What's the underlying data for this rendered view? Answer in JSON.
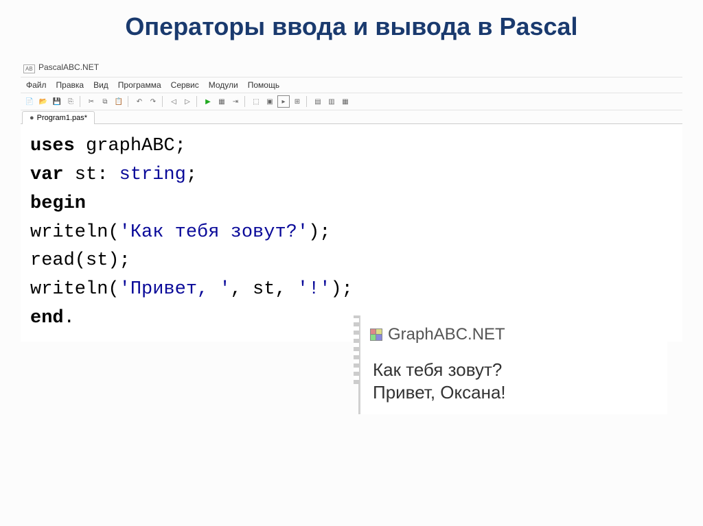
{
  "slide": {
    "title": "Операторы ввода и вывода в Pascal"
  },
  "app": {
    "title": "PascalABC.NET"
  },
  "menu": {
    "file": "Файл",
    "edit": "Правка",
    "view": "Вид",
    "program": "Программа",
    "service": "Сервис",
    "modules": "Модули",
    "help": "Помощь"
  },
  "tab": {
    "label": "Program1.pas*"
  },
  "code": {
    "uses_kw": "uses",
    "uses_val": " graphABC;",
    "var_kw": "var",
    "var_decl_a": " st: ",
    "var_type": "string",
    "var_decl_b": ";",
    "begin_kw": "begin",
    "l1_a": "writeln(",
    "l1_str": "'Как тебя зовут?'",
    "l1_b": ");",
    "l2": "read(st);",
    "l3_a": "writeln(",
    "l3_s1": "'Привет, '",
    "l3_b": ", st, ",
    "l3_s2": "'!'",
    "l3_c": ");",
    "end_kw": "end",
    "end_dot": "."
  },
  "output": {
    "title": "GraphABC.NET",
    "line1": "Как тебя зовут?",
    "line2": "Привет, Оксана!"
  }
}
